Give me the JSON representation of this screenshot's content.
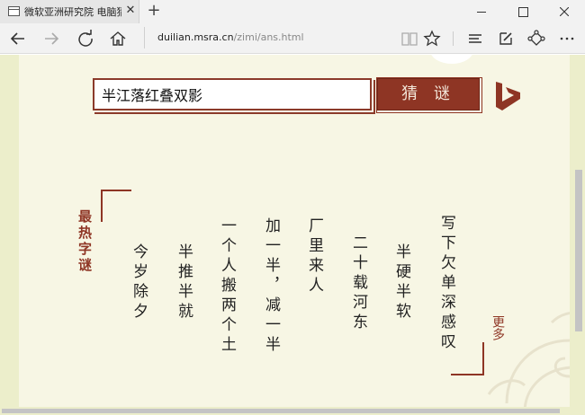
{
  "tab": {
    "title": "微软亚洲研究院 电脑猜字谜",
    "close": "✕",
    "new_tab": "+"
  },
  "address": {
    "host": "duilian.msra.cn",
    "path": "/zimi/ans.html"
  },
  "search": {
    "value": "半江落红叠双影",
    "button_label": "猜 谜"
  },
  "hot_riddles": {
    "title": "最热字谜",
    "items": [
      "今岁除夕",
      "半推半就",
      "一个人搬两个土",
      "加一半，减一半",
      "厂里来人",
      "二十载河东",
      "半硬半软",
      "写下欠单深感叹"
    ],
    "more_label": "更多"
  },
  "colors": {
    "accent": "#8e3524",
    "page_bg": "#f7f6e4",
    "side_bg": "#eceecb"
  },
  "icons": [
    "page-icon",
    "back-icon",
    "forward-icon",
    "refresh-icon",
    "home-icon",
    "reading-view-icon",
    "favorite-star-icon",
    "hub-icon",
    "web-note-icon",
    "share-icon",
    "more-icon",
    "bing-logo-icon"
  ]
}
